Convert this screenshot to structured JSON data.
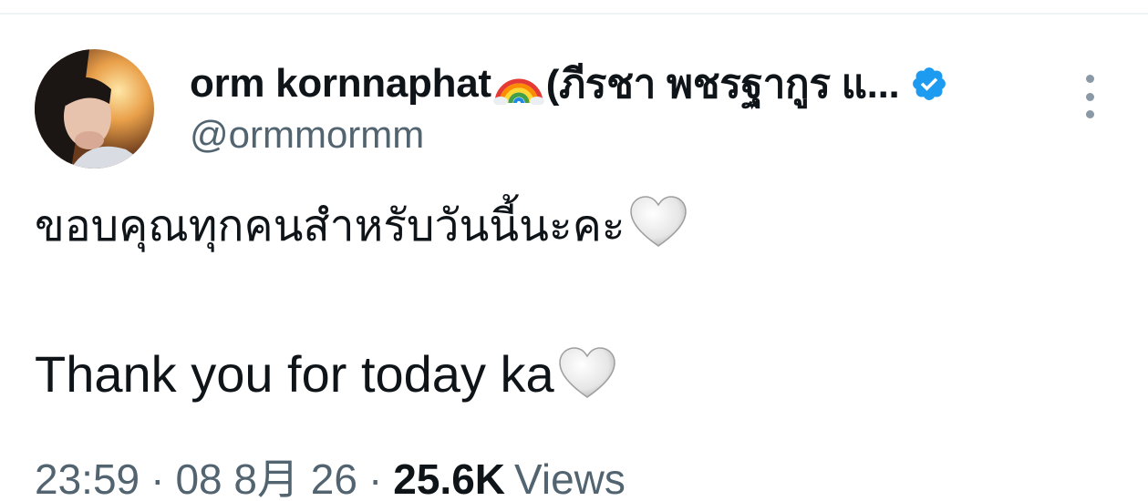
{
  "author": {
    "display_name": "orm kornnaphat",
    "display_name_suffix": "(ภีรชา พชรฐากูร แ...",
    "handle": "@ormmormm",
    "verified": true,
    "rainbow_icon": "rainbow-emoji",
    "verified_icon": "verified-badge-icon",
    "verified_color": "#1d9bf0"
  },
  "tweet": {
    "text_thai": "ขอบคุณทุกคนสำหรับวันนี้นะคะ",
    "text_english": "Thank you for today ka",
    "heart_icon": "white-heart-emoji"
  },
  "meta": {
    "time": "23:59",
    "separator": "·",
    "date": "08 8月 26",
    "views_count": "25.6K",
    "views_label": "Views"
  },
  "colors": {
    "primary_text": "#0f1419",
    "secondary_text": "#536471",
    "divider": "#eff3f4"
  }
}
